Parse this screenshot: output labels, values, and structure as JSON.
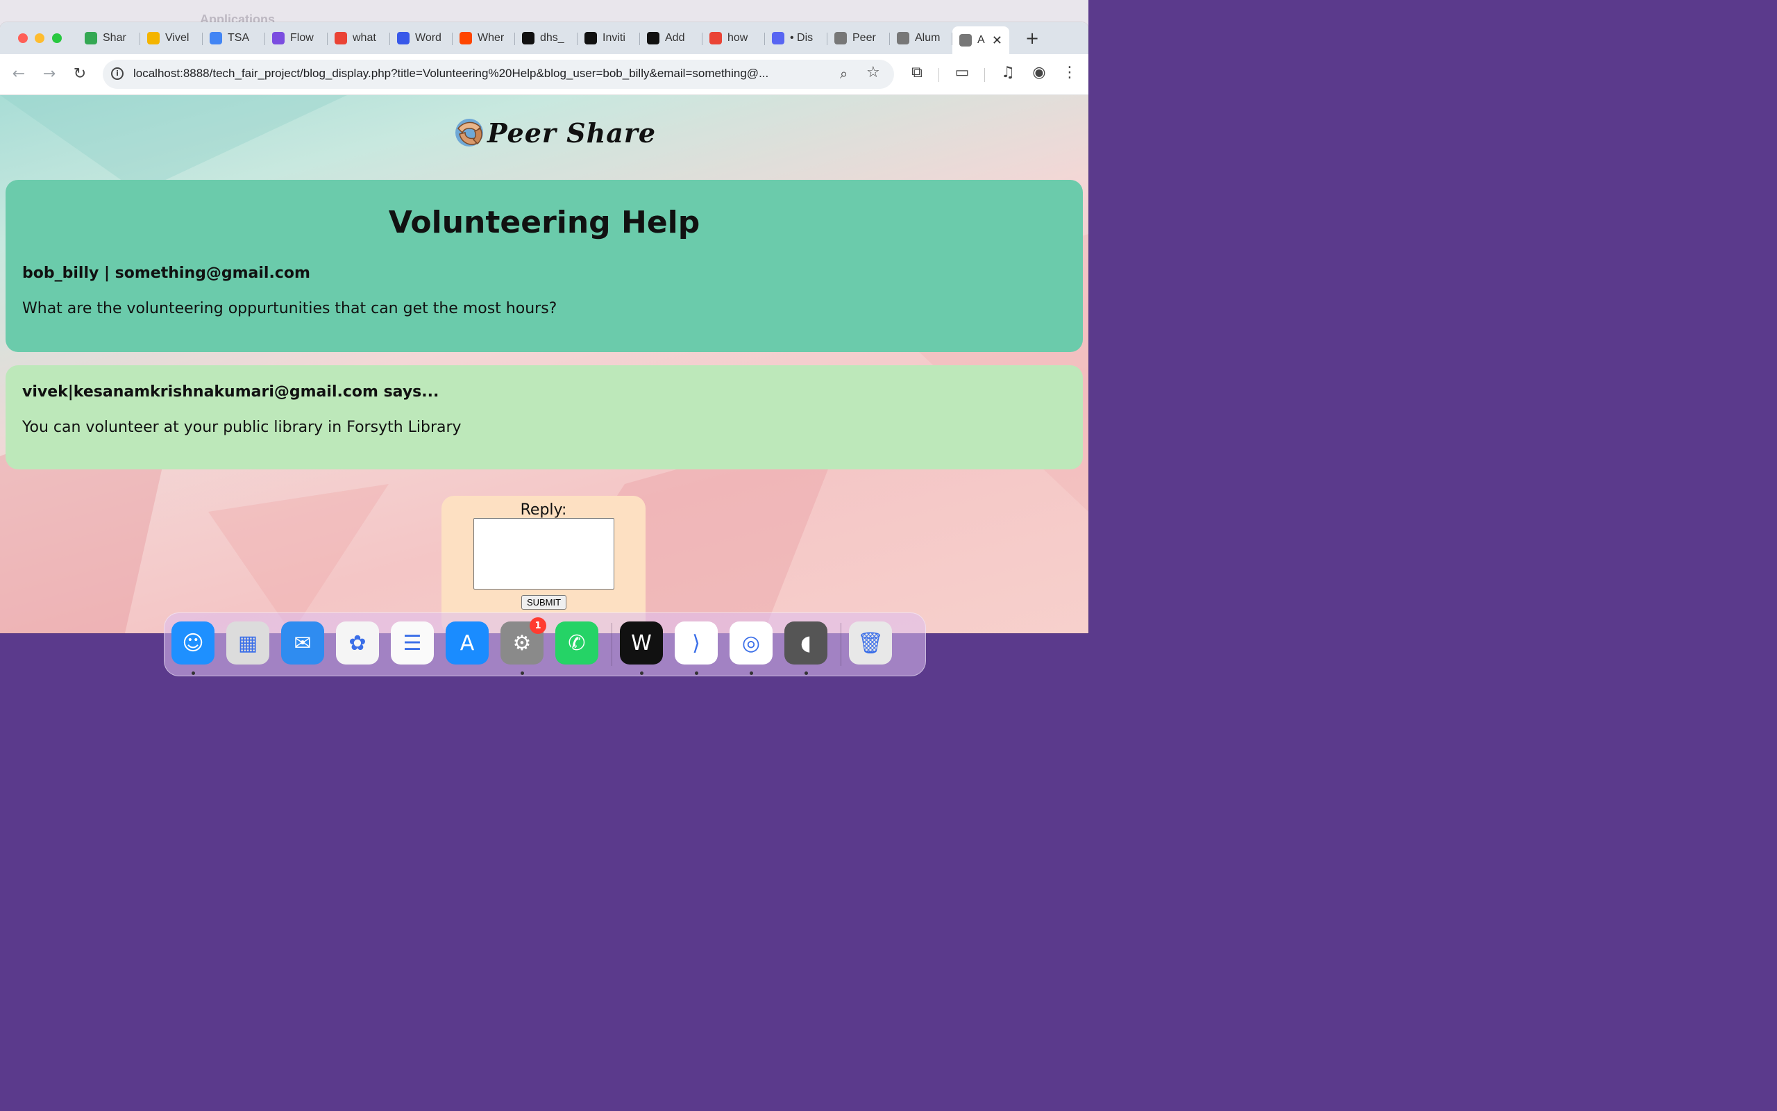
{
  "background_window": {
    "title_fragment": "Applications"
  },
  "browser": {
    "tabs": [
      {
        "label": "Shar",
        "icon": "google-drive-icon",
        "color": "#34a853"
      },
      {
        "label": "Vivel",
        "icon": "google-slides-icon",
        "color": "#f4b400"
      },
      {
        "label": "TSA",
        "icon": "google-docs-icon",
        "color": "#4285f4"
      },
      {
        "label": "Flow",
        "icon": "flowchart-app-icon",
        "color": "#7b4de0"
      },
      {
        "label": "what",
        "icon": "google-icon",
        "color": "#ea4335"
      },
      {
        "label": "Word",
        "icon": "wordpress-icon",
        "color": "#3858e9"
      },
      {
        "label": "Wher",
        "icon": "reddit-icon",
        "color": "#ff4500"
      },
      {
        "label": "dhs_",
        "icon": "github-icon",
        "color": "#111111"
      },
      {
        "label": "Inviti",
        "icon": "github-icon",
        "color": "#111111"
      },
      {
        "label": "Add",
        "icon": "github-icon",
        "color": "#111111"
      },
      {
        "label": "how",
        "icon": "google-icon",
        "color": "#ea4335"
      },
      {
        "label": "• Dis",
        "icon": "discord-icon",
        "color": "#5865f2"
      },
      {
        "label": "Peer",
        "icon": "elephant-icon",
        "color": "#777777"
      },
      {
        "label": "Alum",
        "icon": "elephant-icon",
        "color": "#777777"
      }
    ],
    "active_tab": {
      "label": "A",
      "icon": "elephant-icon"
    },
    "url": "localhost:8888/tech_fair_project/blog_display.php?title=Volunteering%20Help&blog_user=bob_billy&email=something@..."
  },
  "site": {
    "logo_text": "Peer Share"
  },
  "post": {
    "title": "Volunteering Help",
    "meta": "bob_billy | something@gmail.com",
    "body": "What are the volunteering oppurtunities that can get the most hours?"
  },
  "replies": [
    {
      "meta": "vivek|kesanamkrishnakumari@gmail.com says...",
      "body": "You can volunteer at your public library in Forsyth Library"
    }
  ],
  "reply_form": {
    "label": "Reply:",
    "value": "",
    "submit_label": "SUBMIT"
  },
  "dock": {
    "apps": [
      {
        "name": "finder",
        "color": "#1e90ff",
        "running": true
      },
      {
        "name": "launchpad",
        "color": "#dcdcdc",
        "running": false
      },
      {
        "name": "mail",
        "color": "#2f8cf0",
        "running": false
      },
      {
        "name": "photos",
        "color": "#f5f5f5",
        "running": false
      },
      {
        "name": "reminders",
        "color": "#fafafa",
        "running": false
      },
      {
        "name": "app-store",
        "color": "#1a8cff",
        "running": false
      },
      {
        "name": "system-settings",
        "color": "#8a8a8a",
        "running": true,
        "badge": "1"
      },
      {
        "name": "whatsapp",
        "color": "#25d366",
        "running": false
      },
      {
        "name": "webex",
        "color": "#111111",
        "running": true
      },
      {
        "name": "vscode",
        "color": "#ffffff",
        "running": true
      },
      {
        "name": "chrome",
        "color": "#ffffff",
        "running": true
      },
      {
        "name": "mamp",
        "color": "#555555",
        "running": true
      },
      {
        "name": "trash",
        "color": "#e8e8e8",
        "running": false
      }
    ]
  }
}
